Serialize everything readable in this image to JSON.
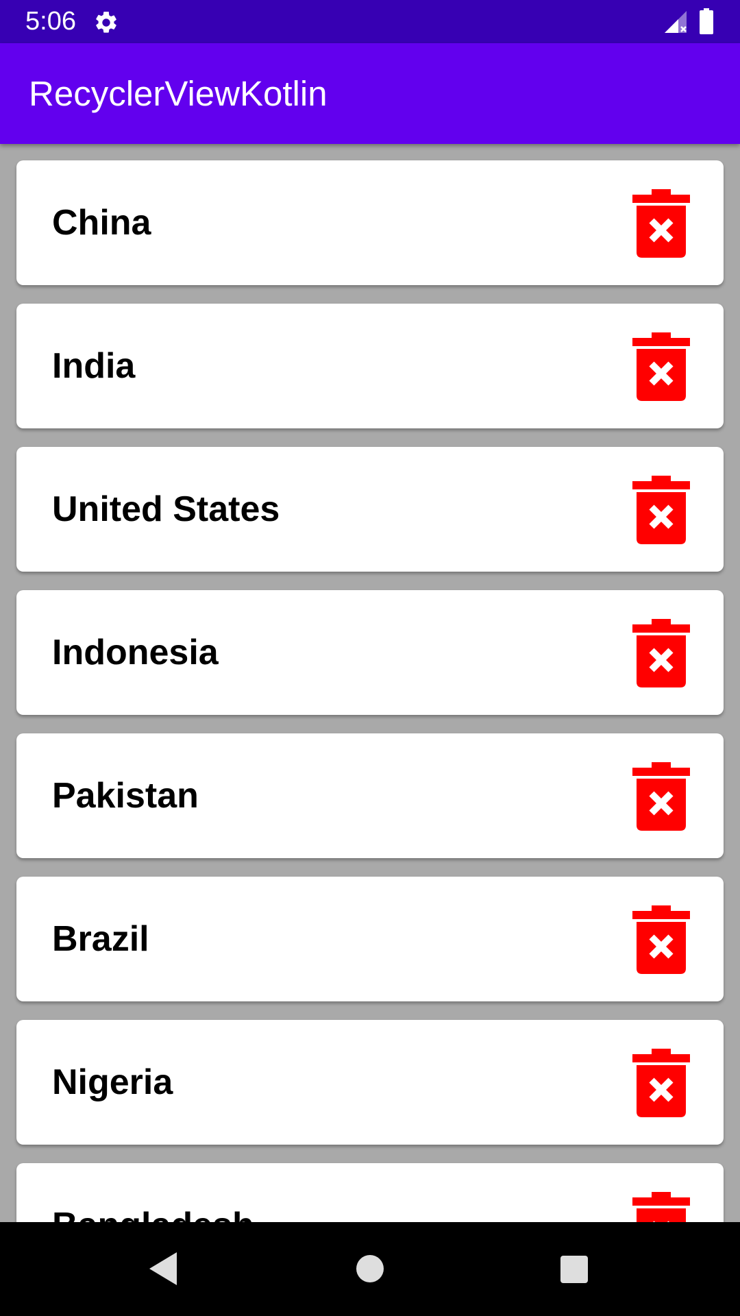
{
  "status_bar": {
    "time": "5:06",
    "icons": [
      "gear-icon",
      "signal-icon",
      "battery-icon"
    ],
    "background": "#3700b3"
  },
  "app_bar": {
    "title": "RecyclerViewKotlin",
    "background": "#6200ee"
  },
  "list": {
    "items": [
      {
        "label": "China"
      },
      {
        "label": "India"
      },
      {
        "label": "United States"
      },
      {
        "label": "Indonesia"
      },
      {
        "label": "Pakistan"
      },
      {
        "label": "Brazil"
      },
      {
        "label": "Nigeria"
      },
      {
        "label": "Bangladesh"
      }
    ],
    "delete_icon": "trash-delete-icon",
    "delete_color": "#ff0000"
  },
  "nav_bar": {
    "icons": [
      "back-icon",
      "home-icon",
      "recents-icon"
    ]
  }
}
